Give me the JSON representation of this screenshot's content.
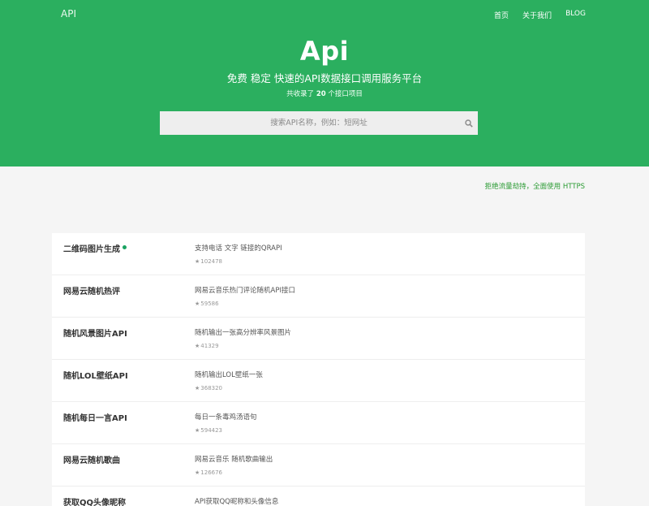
{
  "header": {
    "logo": "API",
    "nav": [
      "首页",
      "关于我们",
      "BLOG"
    ],
    "title": "Api",
    "subtitle": "免费 稳定 快速的API数据接口调用服务平台",
    "count_prefix": "共收录了",
    "count_value": "20",
    "count_suffix": "个接口项目"
  },
  "search": {
    "placeholder": "搜索API名称，例如：短网址"
  },
  "notice": "拒绝流量劫持，全面使用 HTTPS",
  "colors": {
    "hero_bg": "#2baf5f",
    "accent_dot": "#1aa361",
    "notice": "#2a9b33"
  },
  "apis": [
    {
      "name": "二维码图片生成",
      "desc": "支持电话 文字 链接的QRAPI",
      "stars": "102478",
      "new": true
    },
    {
      "name": "网易云随机热评",
      "desc": "网易云音乐热门评论随机API接口",
      "stars": "59586",
      "new": false
    },
    {
      "name": "随机风景图片API",
      "desc": "随机输出一张高分辨率风景图片",
      "stars": "41329",
      "new": false
    },
    {
      "name": "随机LOL壁纸API",
      "desc": "随机输出LOL壁纸一张",
      "stars": "368320",
      "new": false
    },
    {
      "name": "随机每日一言API",
      "desc": "每日一条毒鸡汤语句",
      "stars": "594423",
      "new": false
    },
    {
      "name": "网易云随机歌曲",
      "desc": "网易云音乐 随机歌曲输出",
      "stars": "126676",
      "new": false
    },
    {
      "name": "获取QQ头像昵称",
      "desc": "API获取QQ昵称和头像信息",
      "stars": "",
      "new": false
    }
  ]
}
